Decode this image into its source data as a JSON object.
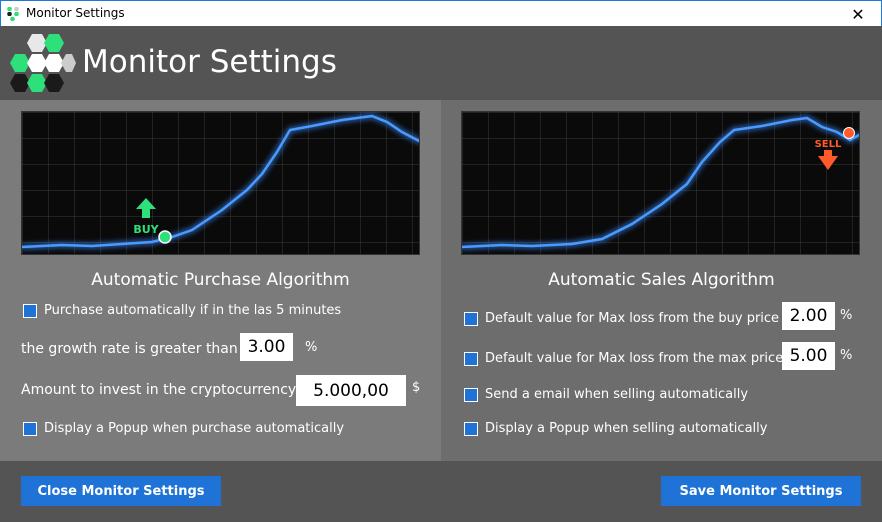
{
  "window": {
    "title": "Monitor Settings",
    "close_glyph": "✕"
  },
  "header": {
    "title": "Monitor Settings",
    "logo_icon": "hexagon-logo-icon"
  },
  "purchase": {
    "title": "Automatic Purchase Algorithm",
    "chart_marker": "BUY",
    "option_auto": "Purchase automatically if in the las 5 minutes",
    "growth_label": "the growth rate is greater than",
    "growth_value": "3.00",
    "growth_unit": "%",
    "amount_label": "Amount to invest in the cryptocurrency",
    "amount_value": "5.000,00",
    "amount_unit": "$",
    "option_popup": "Display a Popup when purchase automatically"
  },
  "sales": {
    "title": "Automatic Sales Algorithm",
    "chart_marker": "SELL",
    "option_buy_loss": "Default value for Max loss from the buy price",
    "buy_loss_value": "2.00",
    "buy_loss_unit": "%",
    "option_max_loss": "Default value for Max loss from the max price",
    "max_loss_value": "5.00",
    "max_loss_unit": "%",
    "option_email": "Send a email when selling automatically",
    "option_popup": "Display a Popup when selling automatically"
  },
  "footer": {
    "close_label": "Close Monitor Settings",
    "save_label": "Save Monitor Settings"
  },
  "colors": {
    "accent": "#1f73d6",
    "header_bg": "#545454",
    "chart_line": "#3a8cff",
    "buy": "#2ee07a",
    "sell": "#ff5a2a"
  }
}
